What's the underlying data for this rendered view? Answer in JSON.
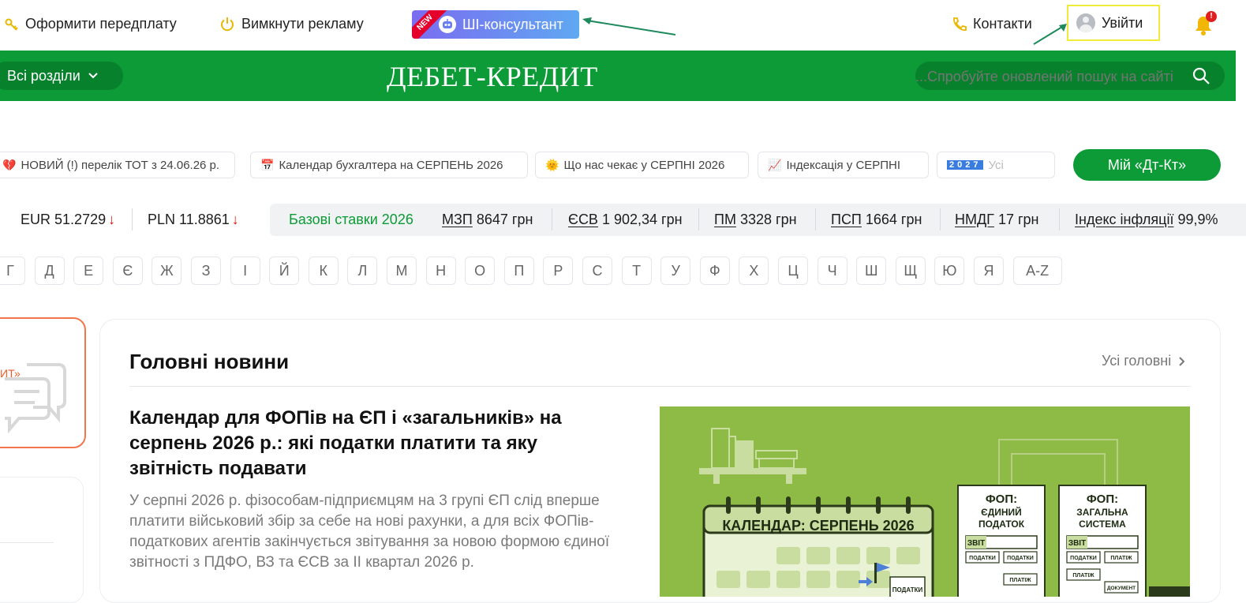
{
  "topbar": {
    "subscribe_label": "Оформити передплату",
    "ads_label": "Вимкнути рекламу",
    "ai_badge": "NEW",
    "ai_label": "ШІ-консультант",
    "contacts_label": "Контакти",
    "login_label": "Увійти",
    "notification_badge": "!"
  },
  "header": {
    "sections_label": "Всі розділи",
    "logo_text": "ДЕБЕТ-КРЕДИТ",
    "search_placeholder": "Спробуйте оновлений пошук на сайті..."
  },
  "chips": [
    {
      "icon": "💔",
      "label": "НОВИЙ (!) перелік ТОТ з 24.06.26 р."
    },
    {
      "icon": "📅",
      "label": "Календар бухгалтера на СЕРПЕНЬ 2026"
    },
    {
      "icon": "🌞",
      "label": "Що нас чекає у СЕРПНІ 2026"
    },
    {
      "icon": "📈",
      "label": "Індексація у СЕРПНІ"
    },
    {
      "icon": "2027",
      "label": "Усі"
    }
  ],
  "my_dtkt_label": "Мій «Дт-Кт»",
  "currency": [
    {
      "code": "EUR",
      "value": "51.2729",
      "trend": "↓"
    },
    {
      "code": "PLN",
      "value": "11.8861",
      "trend": "↓"
    }
  ],
  "base_rates": {
    "title": "Базові ставки 2026",
    "items": [
      {
        "name": "МЗП",
        "value": "8647 грн"
      },
      {
        "name": "ЄСВ",
        "value": "1 902,34 грн"
      },
      {
        "name": "ПМ",
        "value": "3328 грн"
      },
      {
        "name": "ПСП",
        "value": "1664 грн"
      },
      {
        "name": "НМДГ",
        "value": "17 грн"
      },
      {
        "name": "Індекс інфляції",
        "value": "99,9%"
      }
    ]
  },
  "alphabet": [
    "Г",
    "Д",
    "Е",
    "Є",
    "Ж",
    "З",
    "І",
    "Й",
    "К",
    "Л",
    "М",
    "Н",
    "О",
    "П",
    "Р",
    "С",
    "Т",
    "У",
    "Ф",
    "Х",
    "Ц",
    "Ч",
    "Ш",
    "Щ",
    "Ю",
    "Я",
    "A-Z"
  ],
  "promo": {
    "text": "ИТ»"
  },
  "news": {
    "heading": "Головні новини",
    "all_link": "Усі головні",
    "article_title": "Календар для ФОПів на ЄП і «загальників» на серпень 2026 р.: які податки платити та яку звітність подавати",
    "article_lead": "У серпні 2026 р. фізособам-підприємцям на 3 групі ЄП слід вперше платити військовий збір за себе на нові рахунки, а для всіх ФОПів-податкових агентів закінчується звітування за новою формою єдиної звітності з ПДФО, ВЗ та ЄСВ за ІІ квартал 2026 р.",
    "image": {
      "calendar_title": "КАЛЕНДАР: СЕРПЕНЬ 2026",
      "doc1_title": "ФОП: ЄДИНИЙ ПОДАТОК",
      "doc2_title": "ФОП: ЗАГАЛЬНА СИСТЕМА",
      "report": "ЗВІТ",
      "taxes": "ПОДАТКИ",
      "payment": "ПЛАТІЖ",
      "document": "ДОКУМЕНТ"
    }
  },
  "colors": {
    "brand_green": "#0c9b36",
    "dark_green": "#07812b",
    "highlight": "#f1ec3a",
    "arrow": "#1f8a5c"
  }
}
